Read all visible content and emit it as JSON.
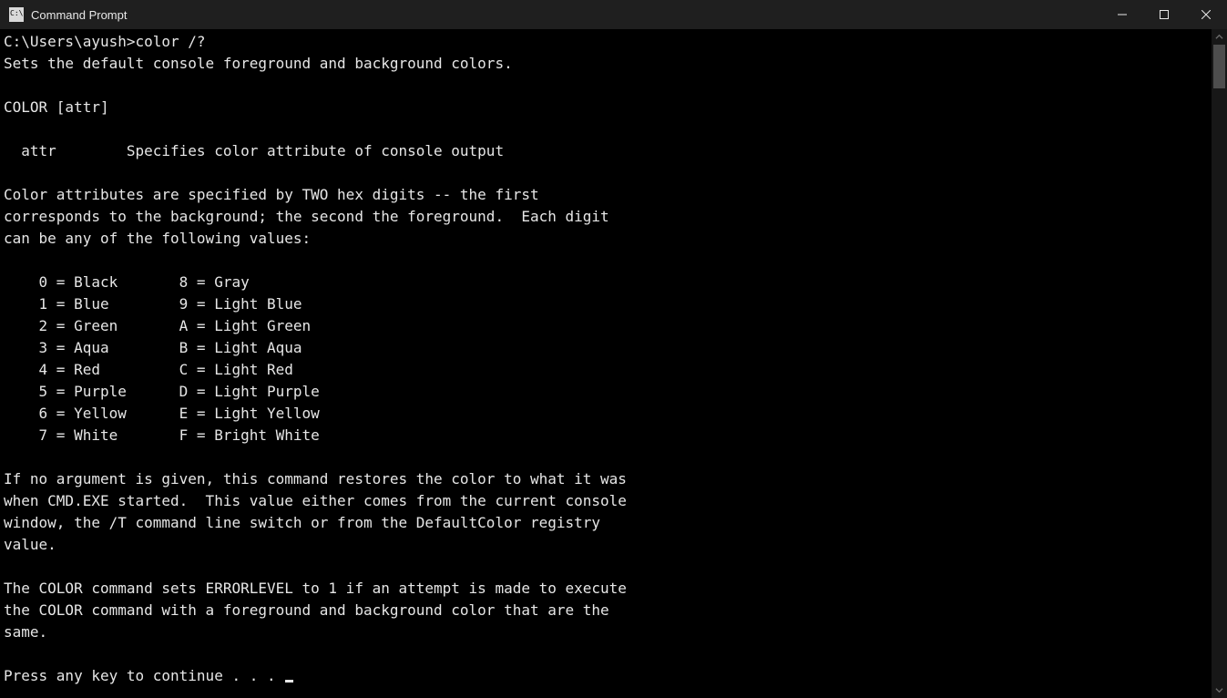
{
  "window": {
    "title": "Command Prompt"
  },
  "console": {
    "prompt_line": "C:\\Users\\ayush>color /?",
    "desc_line": "Sets the default console foreground and background colors.",
    "blank": "",
    "syntax_line": "COLOR [attr]",
    "attr_line": "  attr        Specifies color attribute of console output",
    "para2_l1": "Color attributes are specified by TWO hex digits -- the first",
    "para2_l2": "corresponds to the background; the second the foreground.  Each digit",
    "para2_l3": "can be any of the following values:",
    "table_l1": "    0 = Black       8 = Gray",
    "table_l2": "    1 = Blue        9 = Light Blue",
    "table_l3": "    2 = Green       A = Light Green",
    "table_l4": "    3 = Aqua        B = Light Aqua",
    "table_l5": "    4 = Red         C = Light Red",
    "table_l6": "    5 = Purple      D = Light Purple",
    "table_l7": "    6 = Yellow      E = Light Yellow",
    "table_l8": "    7 = White       F = Bright White",
    "para3_l1": "If no argument is given, this command restores the color to what it was",
    "para3_l2": "when CMD.EXE started.  This value either comes from the current console",
    "para3_l3": "window, the /T command line switch or from the DefaultColor registry",
    "para3_l4": "value.",
    "para4_l1": "The COLOR command sets ERRORLEVEL to 1 if an attempt is made to execute",
    "para4_l2": "the COLOR command with a foreground and background color that are the",
    "para4_l3": "same.",
    "continue_line": "Press any key to continue . . . "
  }
}
